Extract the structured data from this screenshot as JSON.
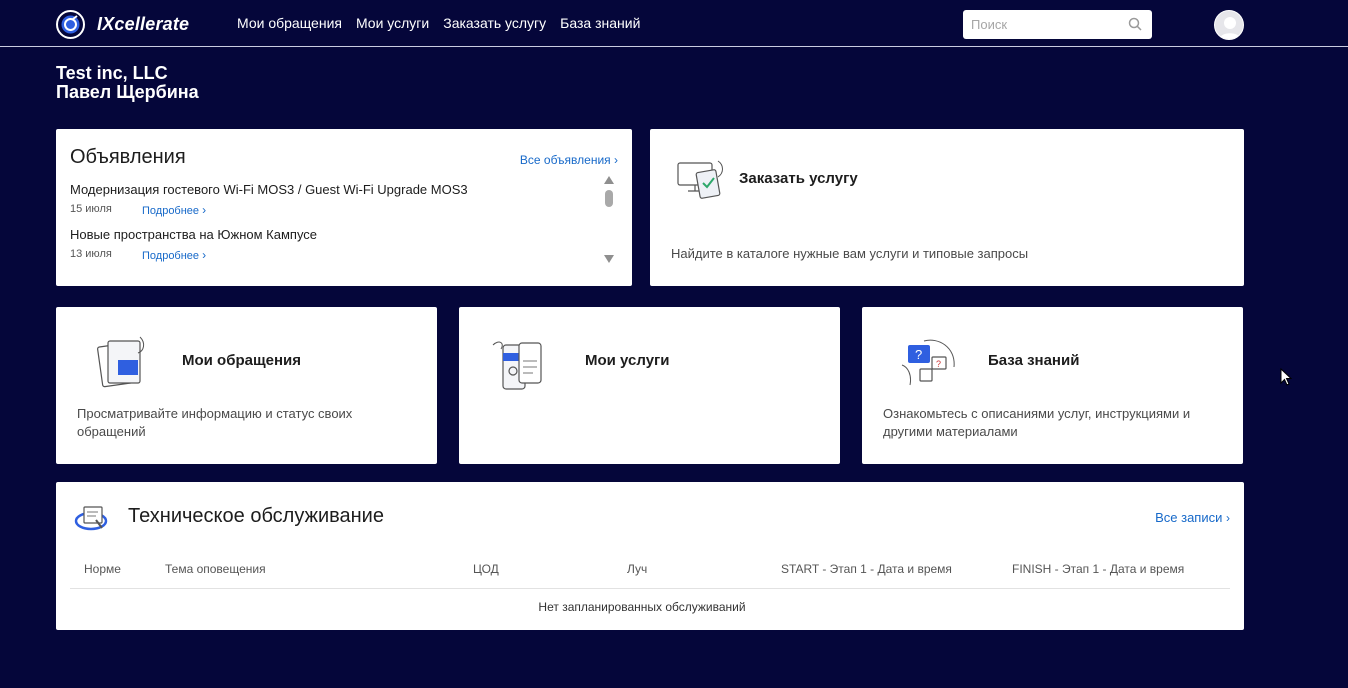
{
  "brand": {
    "name": "IXcellerate"
  },
  "nav": {
    "links": [
      "Мои обращения",
      "Мои услуги",
      "Заказать услугу",
      "База знаний"
    ]
  },
  "search": {
    "placeholder": "Поиск"
  },
  "header": {
    "company": "Test inc, LLC",
    "user": "Павел Щербина"
  },
  "announcements": {
    "title": "Объявления",
    "all_link": "Все объявления",
    "items": [
      {
        "title": "Модернизация гостевого Wi-Fi MOS3 / Guest Wi-Fi Upgrade MOS3",
        "date": "15 июля",
        "more": "Подробнее"
      },
      {
        "title": "Новые пространства на Южном Кампусе",
        "date": "13 июля",
        "more": "Подробнее"
      }
    ]
  },
  "order_service": {
    "title": "Заказать услугу",
    "desc": "Найдите в каталоге нужные вам услуги и типовые запросы"
  },
  "tiles": [
    {
      "title": "Мои обращения",
      "desc": "Просматривайте информацию и статус своих обращений"
    },
    {
      "title": "Мои услуги",
      "desc": ""
    },
    {
      "title": "База знаний",
      "desc": "Ознакомьтесь с описаниями услуг, инструкциями и другими материалами"
    }
  ],
  "maintenance": {
    "title": "Техническое обслуживание",
    "all_link": "Все записи",
    "columns": [
      "Норме",
      "Тема оповещения",
      "ЦОД",
      "Луч",
      "START - Этап 1 - Дата и время",
      "FINISH - Этап 1 - Дата и время"
    ],
    "empty": "Нет запланированных обслуживаний"
  },
  "colors": {
    "background": "#05063a",
    "link": "#1769c9",
    "accent": "#2f5fe0"
  }
}
